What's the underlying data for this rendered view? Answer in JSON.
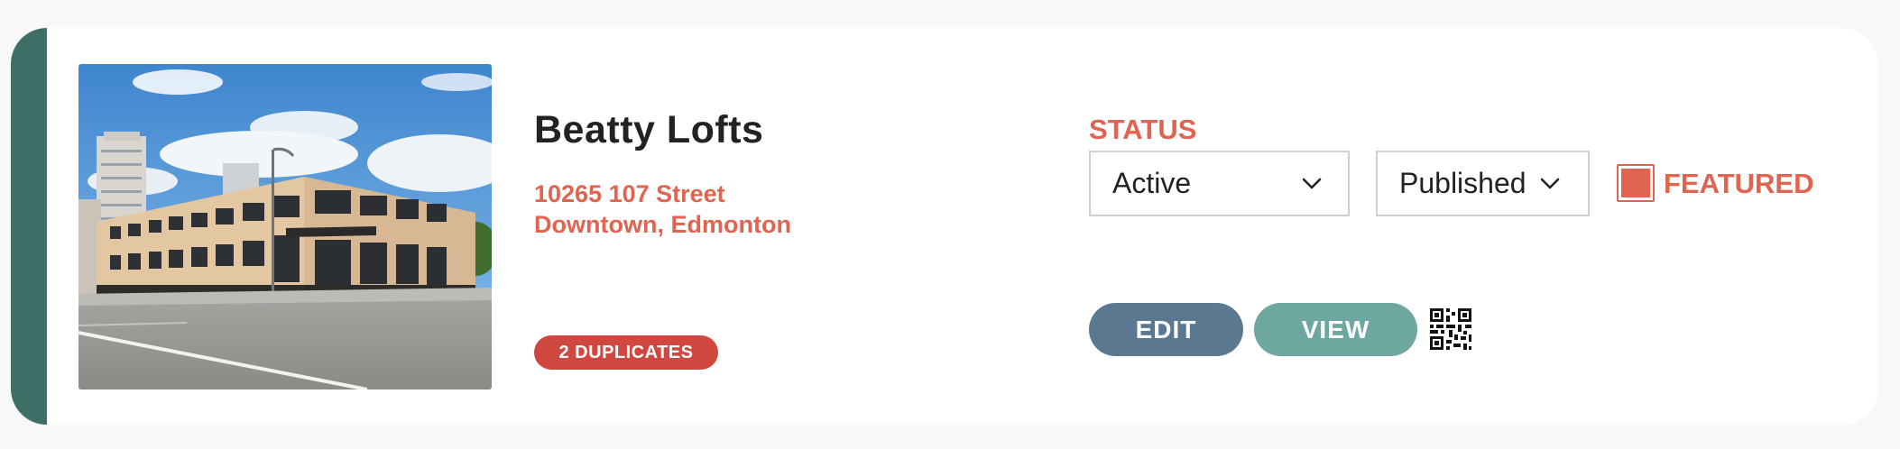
{
  "listing": {
    "title": "Beatty Lofts",
    "address_line1": "10265 107 Street",
    "address_line2": "Downtown, Edmonton",
    "duplicates_badge": "2 DUPLICATES"
  },
  "status": {
    "label": "STATUS",
    "state_value": "Active",
    "publish_value": "Published",
    "featured_label": "FEATURED",
    "featured_checked": true
  },
  "actions": {
    "edit_label": "EDIT",
    "view_label": "VIEW",
    "qr_icon": "qr-code-icon"
  },
  "colors": {
    "accent_bar": "#3f6e66",
    "coral": "#e0644f",
    "badge_red": "#d0473f",
    "edit_button": "#5a7890",
    "view_button": "#6ea7a0"
  }
}
